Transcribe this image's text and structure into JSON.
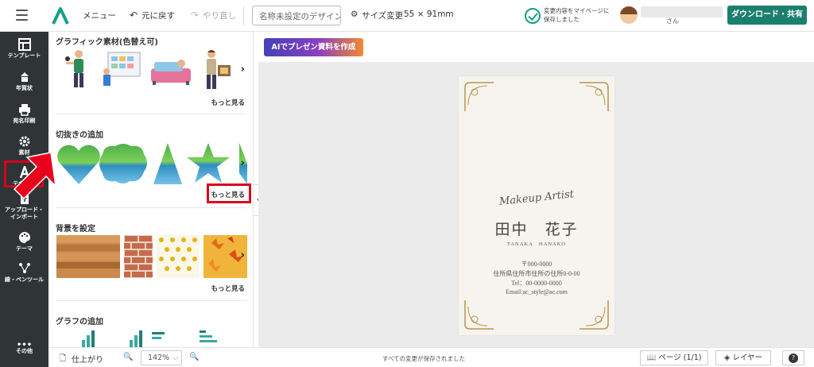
{
  "header": {
    "menu_label": "メニュー",
    "undo_label": "元に戻す",
    "redo_label": "やり直し",
    "design_name_placeholder": "名称未設定のデザイン",
    "size_change_label": "サイズ変更",
    "size_value": "55 × 91mm",
    "saved_line1": "変更内容をマイページに",
    "saved_line2": "保存しました",
    "user_suffix": "さん",
    "download_label": "ダウンロード・共有"
  },
  "rail": {
    "items": [
      {
        "label": "テンプレート",
        "icon": "template-icon"
      },
      {
        "label": "年賀状",
        "icon": "newyear-icon"
      },
      {
        "label": "宛名印刷",
        "icon": "printer-icon"
      },
      {
        "label": "素材",
        "icon": "gear-icon"
      },
      {
        "label": "テキ",
        "icon": "text-icon"
      },
      {
        "label": "アップロード・",
        "label2": "インポート",
        "icon": "upload-icon"
      },
      {
        "label": "テーマ",
        "icon": "palette-icon"
      },
      {
        "label": "線・ペンツール",
        "icon": "pen-icon"
      },
      {
        "label": "その他",
        "icon": "more-icon"
      }
    ]
  },
  "panel": {
    "graphics_title": "グラフィック素材(色替え可)",
    "cutout_title": "切抜きの追加",
    "background_title": "背景を設定",
    "graph_title": "グラフの追加",
    "more_label": "もっと見る"
  },
  "canvas": {
    "ai_button": "AIでプレゼン資料を作成",
    "card": {
      "script_line": "Makeup Artist",
      "name": "田中　花子",
      "name_romaji": "TANAKA　HANAKO",
      "postal": "〒000-0000",
      "address": "住所県住所市住所の住所0-0-00",
      "tel": "Tel：00-0000-0000",
      "email": "Email:ac_style@ac.com"
    }
  },
  "footer": {
    "finish_label": "仕上がり",
    "zoom_value": "142%",
    "status_text": "すべての変更が保存されました",
    "page_label": "ページ",
    "page_count": "(1/1)",
    "layer_label": "レイヤー",
    "help_label": "?"
  },
  "colors": {
    "brand_green": "#1a7f6e",
    "rail_bg": "#2f3437",
    "highlight_red": "#d9001b"
  }
}
